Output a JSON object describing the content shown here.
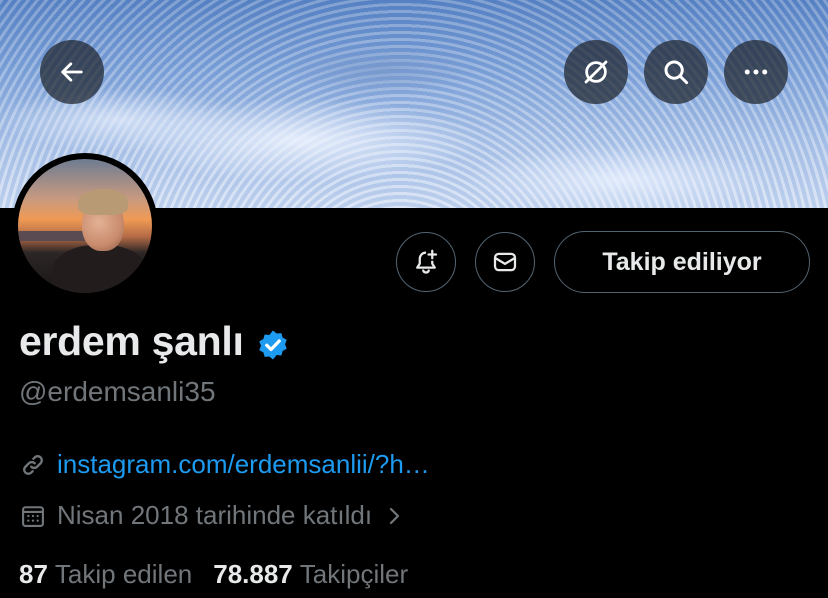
{
  "header": {
    "back_icon": "arrow-left-icon",
    "grok_icon": "slashed-circle-icon",
    "search_icon": "search-icon",
    "more_icon": "more-horizontal-icon"
  },
  "profile": {
    "name": "erdem şanlı",
    "verified": true,
    "handle": "@erdemsanli35",
    "link": "instagram.com/erdemsanlii/?h…",
    "joined": "Nisan 2018 tarihinde katıldı",
    "following_count": "87",
    "following_label": "Takip edilen",
    "followers_count": "78.887",
    "followers_label": "Takipçiler"
  },
  "actions": {
    "notify_icon": "bell-plus-icon",
    "message_icon": "envelope-icon",
    "follow_label": "Takip ediliyor"
  },
  "colors": {
    "background": "#000000",
    "text": "#e7e9ea",
    "secondary": "#71767b",
    "link": "#1d9bf0",
    "verified": "#1d9bf0",
    "border": "#536471"
  }
}
